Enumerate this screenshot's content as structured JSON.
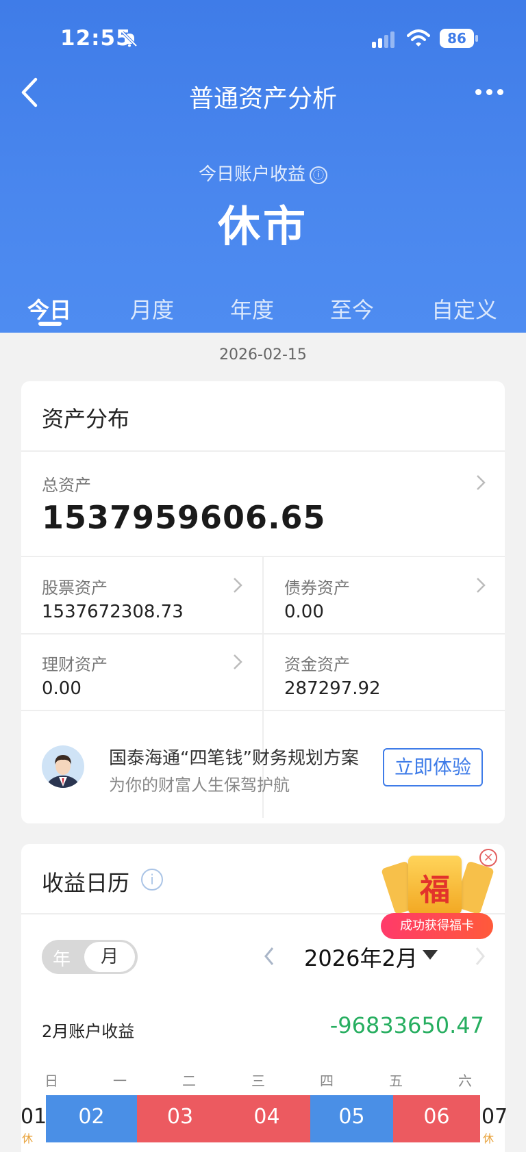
{
  "status": {
    "time": "12:55",
    "battery": "86"
  },
  "nav": {
    "title": "普通资产分析"
  },
  "hero": {
    "subtitle": "今日账户收益",
    "info_icon": "ⓘ",
    "status": "休市"
  },
  "tabs": [
    {
      "label": "今日"
    },
    {
      "label": "月度"
    },
    {
      "label": "年度"
    },
    {
      "label": "至今"
    },
    {
      "label": "自定义"
    }
  ],
  "date": "2026-02-15",
  "assets": {
    "title": "资产分布",
    "total_label": "总资产",
    "total_value": "1537959606.65",
    "items": [
      {
        "label": "股票资产",
        "value": "1537672308.73"
      },
      {
        "label": "债券资产",
        "value": "0.00"
      },
      {
        "label": "理财资产",
        "value": "0.00"
      },
      {
        "label": "资金资产",
        "value": "287297.92"
      }
    ]
  },
  "promo": {
    "title": "国泰海通“四笔钱”财务规划方案",
    "subtitle": "为你的财富人生保驾护航",
    "button": "立即体验"
  },
  "calendar": {
    "title": "收益日历",
    "toggle_year": "年",
    "toggle_month": "月",
    "month": "2026年2月",
    "income_label": "2月账户收益",
    "income_value": "-96833650.47",
    "weekdays": [
      "日",
      "一",
      "二",
      "三",
      "四",
      "五",
      "六"
    ],
    "days": [
      {
        "day": "01",
        "color": "none"
      },
      {
        "day": "02",
        "color": "#4a8fe6"
      },
      {
        "day": "03",
        "color": "#ec5a60"
      },
      {
        "day": "04",
        "color": "#ec5a60"
      },
      {
        "day": "05",
        "color": "#4a8fe6"
      },
      {
        "day": "06",
        "color": "#ec5a60"
      },
      {
        "day": "07",
        "color": "none"
      }
    ],
    "rest_label": "休"
  },
  "badge": {
    "fu": "福",
    "ribbon": "成功获得福卡"
  },
  "colors": {
    "primary": "#3f7ce8",
    "gain": "#27ae60",
    "up": "#ec5a60",
    "down": "#4a8fe6"
  }
}
